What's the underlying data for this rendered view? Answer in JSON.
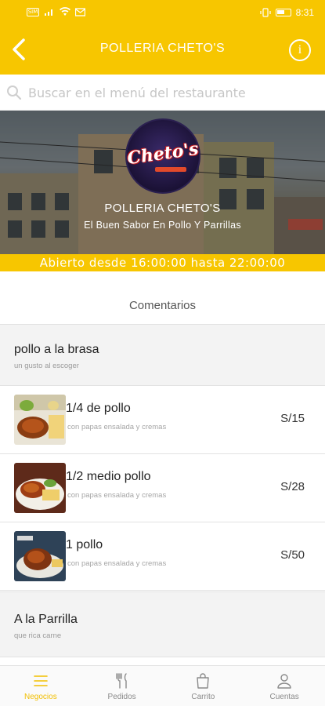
{
  "status_bar": {
    "time": "8:31",
    "sim_label": "SIM"
  },
  "header": {
    "title": "POLLERIA CHETO'S"
  },
  "search": {
    "placeholder": "Buscar en el menú del restaurante"
  },
  "restaurant": {
    "logo_text": "Cheto's",
    "name": "POLLERIA CHETO'S",
    "tagline": "El Buen Sabor En Pollo Y Parrillas",
    "hours": "Abierto desde 16:00:00 hasta 22:00:00"
  },
  "comments_label": "Comentarios",
  "menu": {
    "categories": [
      {
        "title": "pollo a la brasa",
        "subtitle": "un gusto al escoger",
        "items": [
          {
            "name": "1/4 de pollo",
            "description": "con papas ensalada y cremas",
            "price": "S/15"
          },
          {
            "name": "1/2 medio pollo",
            "description": "con papas ensalada y cremas",
            "price": "S/28"
          },
          {
            "name": "1 pollo",
            "description": "con papas ensalada y cremas",
            "price": "S/50"
          }
        ]
      },
      {
        "title": "A la Parrilla",
        "subtitle": "que rica carne",
        "items": []
      }
    ]
  },
  "bottom_nav": [
    {
      "label": "Negocios",
      "icon": "list-icon",
      "active": true
    },
    {
      "label": "Pedidos",
      "icon": "utensils-icon",
      "active": false
    },
    {
      "label": "Carrito",
      "icon": "shopping-bag-icon",
      "active": false
    },
    {
      "label": "Cuentas",
      "icon": "user-icon",
      "active": false
    }
  ],
  "colors": {
    "brand": "#f7c600",
    "active_nav": "#f2bf00"
  }
}
